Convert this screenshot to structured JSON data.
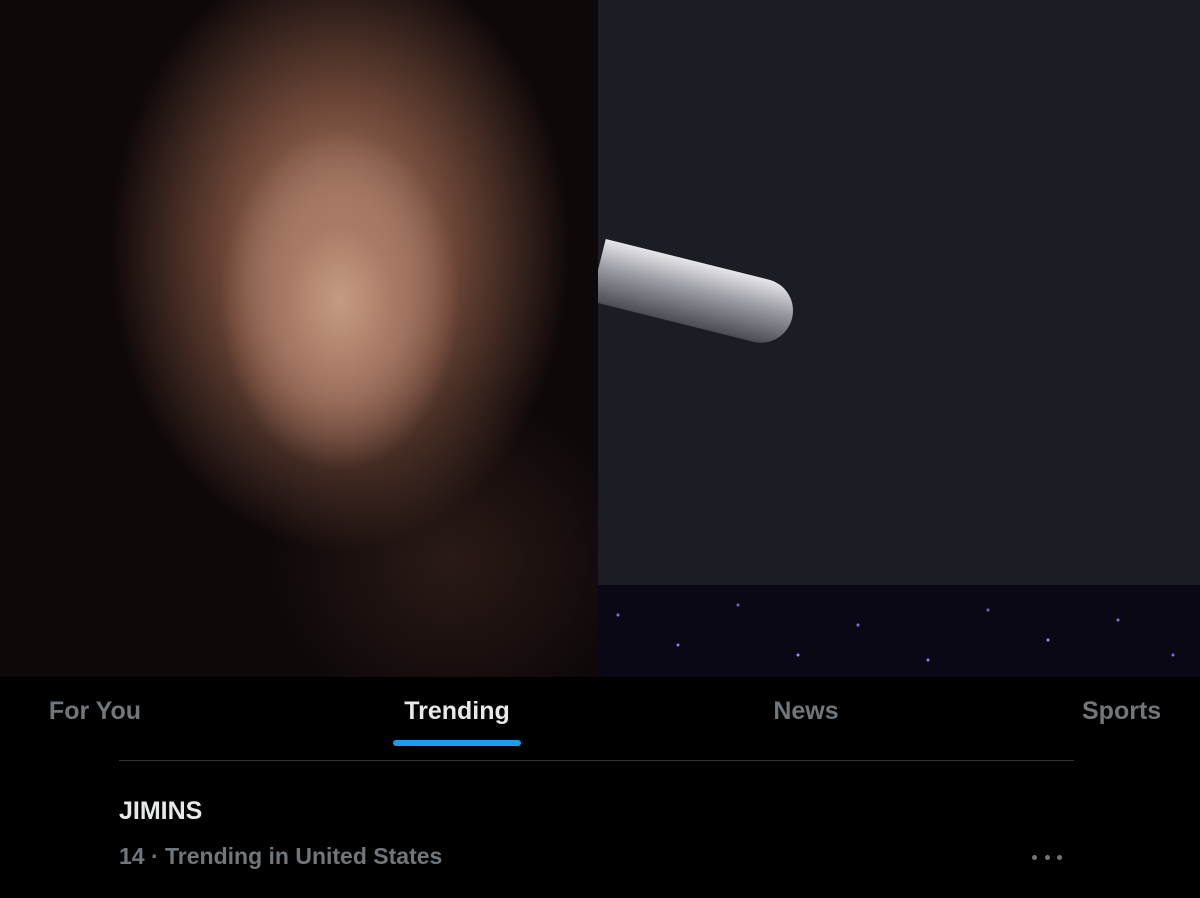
{
  "tabs": [
    {
      "label": "For You",
      "active": false
    },
    {
      "label": "Trending",
      "active": true
    },
    {
      "label": "News",
      "active": false
    },
    {
      "label": "Sports",
      "active": false
    }
  ],
  "trend": {
    "name": "JIMINS",
    "meta": "14 · Trending in United States",
    "more_icon": "more-horizontal-icon"
  },
  "colors": {
    "background": "#000000",
    "active_text": "#e7e9ea",
    "inactive_text": "#71767b",
    "accent": "#1d9bf0",
    "divider": "#2f3336"
  }
}
